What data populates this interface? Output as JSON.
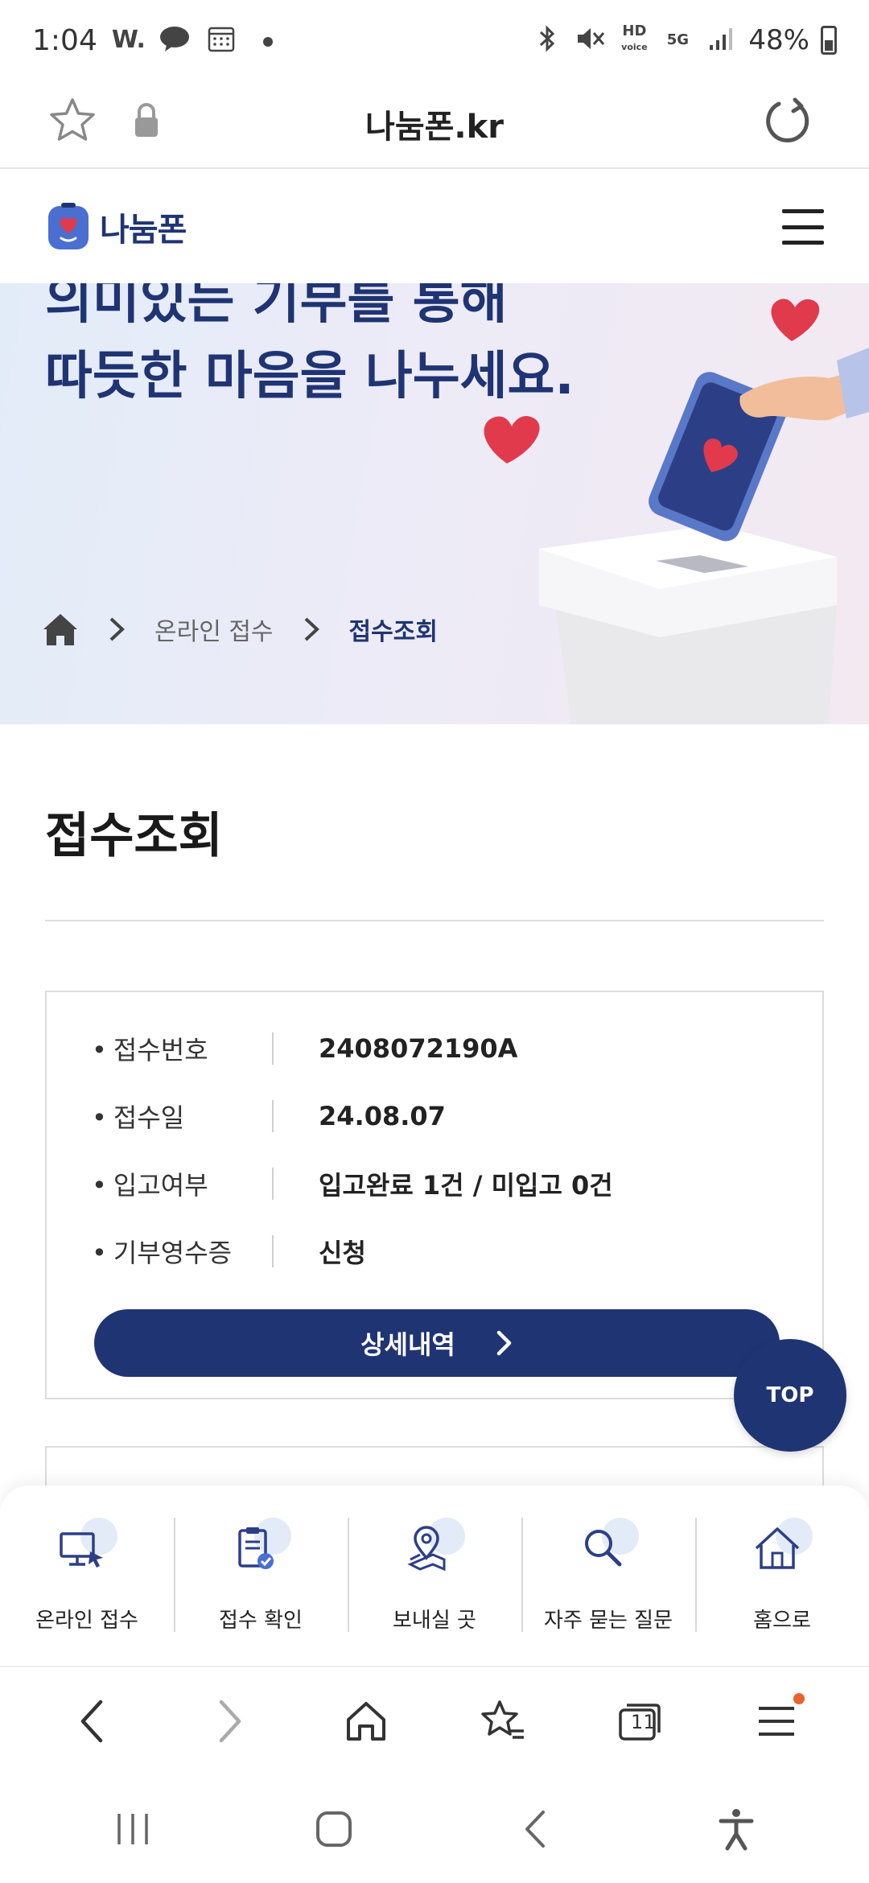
{
  "status_bar": {
    "time": "1:04",
    "left_icons": [
      "w-app-icon",
      "chat-bubble-icon",
      "calendar-icon",
      "dot-icon"
    ],
    "right_icons": [
      "bluetooth-icon",
      "mute-icon",
      "hd-voice-icon",
      "5g-icon",
      "signal-icon"
    ],
    "battery": "48%"
  },
  "browser": {
    "url": "나눔폰.kr",
    "toolbar_icons": [
      "back-icon",
      "forward-icon",
      "home-icon",
      "bookmarks-icon",
      "tabs-icon",
      "menu-icon"
    ],
    "tab_count": "11"
  },
  "header": {
    "logo_text": "나눔폰"
  },
  "hero": {
    "line1": "의미있는 기부를 통해",
    "line2": "따듯한 마음을 나누세요."
  },
  "breadcrumb": {
    "items": [
      "온라인 접수",
      "접수조회"
    ]
  },
  "page": {
    "title": "접수조회"
  },
  "receipt": {
    "rows": [
      {
        "label": "접수번호",
        "value": "2408072190A"
      },
      {
        "label": "접수일",
        "value": "24.08.07"
      },
      {
        "label": "입고여부",
        "value": "입고완료 1건 / 미입고 0건"
      },
      {
        "label": "기부영수증",
        "value": "신청"
      }
    ],
    "detail_button": "상세내역"
  },
  "top_button": "TOP",
  "quick_menu": [
    {
      "label": "온라인 접수",
      "icon": "monitor-cursor-icon"
    },
    {
      "label": "접수 확인",
      "icon": "clipboard-check-icon"
    },
    {
      "label": "보내실 곳",
      "icon": "map-pin-icon"
    },
    {
      "label": "자주 묻는 질문",
      "icon": "search-icon"
    },
    {
      "label": "홈으로",
      "icon": "home-icon"
    }
  ],
  "colors": {
    "brand_navy": "#1f3473",
    "heart_red": "#e03a4c",
    "notification_orange": "#e8642a"
  }
}
